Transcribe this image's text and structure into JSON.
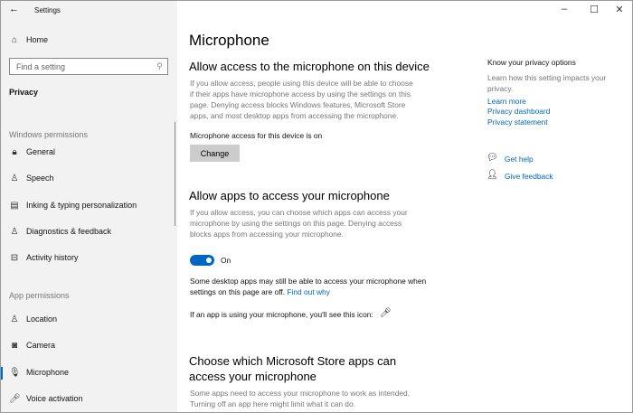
{
  "window": {
    "title": "Settings",
    "back_icon": "arrow-left",
    "minimize": "–",
    "maximize": "☐",
    "close": "✕"
  },
  "sidebar": {
    "home": "Home",
    "search_placeholder": "Find a setting",
    "category": "Privacy",
    "windows_permissions": "Windows permissions",
    "windows_items": [
      {
        "label": "General",
        "icon": "lock"
      },
      {
        "label": "Speech",
        "icon": "speech"
      },
      {
        "label": "Inking & typing personalization",
        "icon": "clipboard"
      },
      {
        "label": "Diagnostics & feedback",
        "icon": "diagnostics"
      },
      {
        "label": "Activity history",
        "icon": "activity"
      }
    ],
    "app_permissions": "App permissions",
    "app_items": [
      {
        "label": "Location",
        "icon": "location"
      },
      {
        "label": "Camera",
        "icon": "camera"
      },
      {
        "label": "Microphone",
        "icon": "microphone",
        "selected": true
      },
      {
        "label": "Voice activation",
        "icon": "microphone-filled"
      }
    ]
  },
  "main": {
    "title": "Microphone",
    "device": {
      "heading": "Allow access to the microphone on this device",
      "desc": "If you allow access, people using this device will be able to choose if their apps have microphone access by using the settings on this page. Denying access blocks Windows features, Microsoft Store apps, and most desktop apps from accessing the microphone.",
      "status": "Microphone access for this device is on",
      "button": "Change"
    },
    "apps": {
      "heading": "Allow apps to access your microphone",
      "desc": "If you allow access, you can choose which apps can access your microphone by using the settings on this page. Denying access blocks apps from accessing your microphone.",
      "toggle_on": true,
      "toggle_label": "On",
      "note": "Some desktop apps may still be able to access your microphone when settings on this page are off.",
      "note_link": "Find out why",
      "icon_note": "If an app is using your microphone, you'll see this icon:"
    },
    "store": {
      "heading": "Choose which Microsoft Store apps can access your microphone",
      "desc": "Some apps need to access your microphone to work as intended. Turning off an app here might limit what it can do."
    }
  },
  "right": {
    "heading": "Know your privacy options",
    "desc": "Learn how this setting impacts your privacy.",
    "links": [
      "Learn more",
      "Privacy dashboard",
      "Privacy statement"
    ],
    "help": "Get help",
    "feedback": "Give feedback"
  },
  "colors": {
    "accent": "#0067c0",
    "link": "#0067b8",
    "sidebar": "#f2f2f2"
  }
}
